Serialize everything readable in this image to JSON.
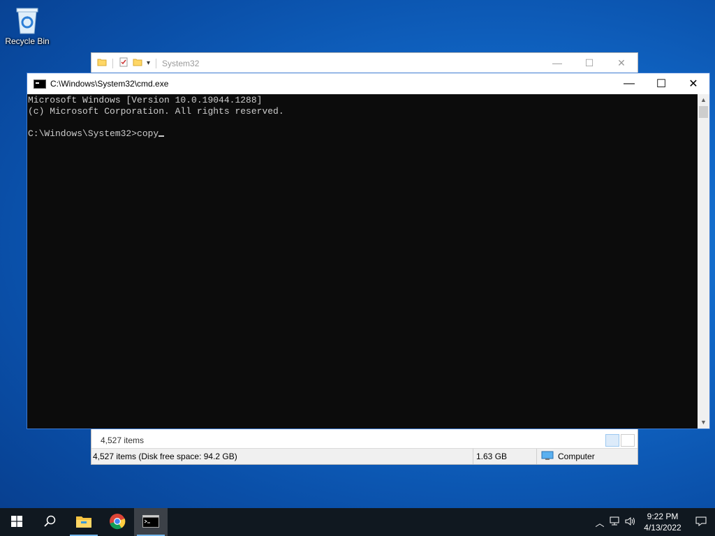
{
  "desktop": {
    "recycle_bin_label": "Recycle Bin"
  },
  "explorer": {
    "title": "System32",
    "items_count_label": "4,527 items",
    "status": {
      "items_disk": "4,527 items (Disk free space: 94.2 GB)",
      "size": "1.63 GB",
      "location": "Computer"
    },
    "controls": {
      "minimize": "—",
      "maximize": "☐",
      "close": "✕"
    }
  },
  "cmd": {
    "title": "C:\\Windows\\System32\\cmd.exe",
    "lines": [
      "Microsoft Windows [Version 10.0.19044.1288]",
      "(c) Microsoft Corporation. All rights reserved.",
      "",
      "C:\\Windows\\System32>copy"
    ],
    "controls": {
      "minimize": "—",
      "maximize": "☐",
      "close": "✕"
    }
  },
  "taskbar": {
    "start_icon": "windows-logo-icon",
    "search_icon": "search-icon",
    "apps": [
      {
        "name": "file-explorer",
        "icon": "folder-icon",
        "running": true
      },
      {
        "name": "chrome",
        "icon": "chrome-icon",
        "running": false
      },
      {
        "name": "cmd",
        "icon": "cmd-icon",
        "running": true,
        "active": true
      }
    ],
    "clock": {
      "time": "9:22 PM",
      "date": "4/13/2022"
    }
  },
  "colors": {
    "console_bg": "#0c0c0c",
    "console_text": "#cccccc",
    "taskbar_bg": "#101820",
    "accent": "#76b9ed"
  }
}
